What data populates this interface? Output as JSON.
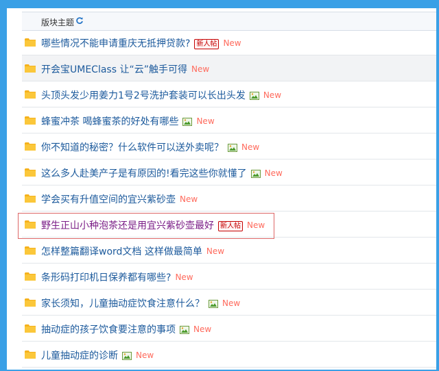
{
  "header": {
    "title": "版块主题"
  },
  "threads": [
    {
      "title": "哪些情况不能申请重庆无抵押贷款?",
      "image": false,
      "newbie": true,
      "new": "New",
      "visited": false,
      "alt": false
    },
    {
      "title": "开会宝UMEClass 让“云”触手可得",
      "image": false,
      "newbie": false,
      "new": "New",
      "visited": false,
      "alt": true
    },
    {
      "title": "头顶头发少用姜力1号2号洗护套装可以长出头发",
      "image": true,
      "newbie": false,
      "new": "New",
      "visited": false,
      "alt": false
    },
    {
      "title": "蜂蜜冲茶 喝蜂蜜茶的好处有哪些",
      "image": true,
      "newbie": false,
      "new": "New",
      "visited": false,
      "alt": false
    },
    {
      "title": "你不知道的秘密？什么软件可以送外卖呢？",
      "image": true,
      "newbie": false,
      "new": "New",
      "visited": false,
      "alt": false
    },
    {
      "title": "这么多人赴美产子是有原因的!看完这些你就懂了",
      "image": true,
      "newbie": false,
      "new": "New",
      "visited": false,
      "alt": false
    },
    {
      "title": "学会买有升值空间的宜兴紫砂壶",
      "image": false,
      "newbie": false,
      "new": "New",
      "visited": false,
      "alt": false
    },
    {
      "title": "野生正山小种泡茶还是用宜兴紫砂壶最好",
      "image": false,
      "newbie": true,
      "new": "New",
      "visited": true,
      "alt": false
    },
    {
      "title": "怎样整篇翻译word文档 这样做最简单",
      "image": false,
      "newbie": false,
      "new": "New",
      "visited": false,
      "alt": false
    },
    {
      "title": "条形码打印机日保养都有哪些?",
      "image": false,
      "newbie": false,
      "new": "New",
      "visited": false,
      "alt": false
    },
    {
      "title": "家长须知，儿童抽动症饮食注意什么？",
      "image": true,
      "newbie": false,
      "new": "New",
      "visited": false,
      "alt": false
    },
    {
      "title": "抽动症的孩子饮食要注意的事项",
      "image": true,
      "newbie": false,
      "new": "New",
      "visited": false,
      "alt": false
    },
    {
      "title": "儿童抽动症的诊断",
      "image": true,
      "newbie": false,
      "new": "New",
      "visited": false,
      "alt": false
    }
  ],
  "badge_label": "新人帖",
  "colors": {
    "frame": "#3aa0e6",
    "link": "#1c5a9c",
    "visited": "#7a1c86",
    "new": "#ff6a5c",
    "badge": "#c40000",
    "highlight": "#dd6666"
  },
  "icons": {
    "folder": "folder-icon",
    "image": "image-attachment-icon",
    "refresh": "refresh-icon"
  }
}
